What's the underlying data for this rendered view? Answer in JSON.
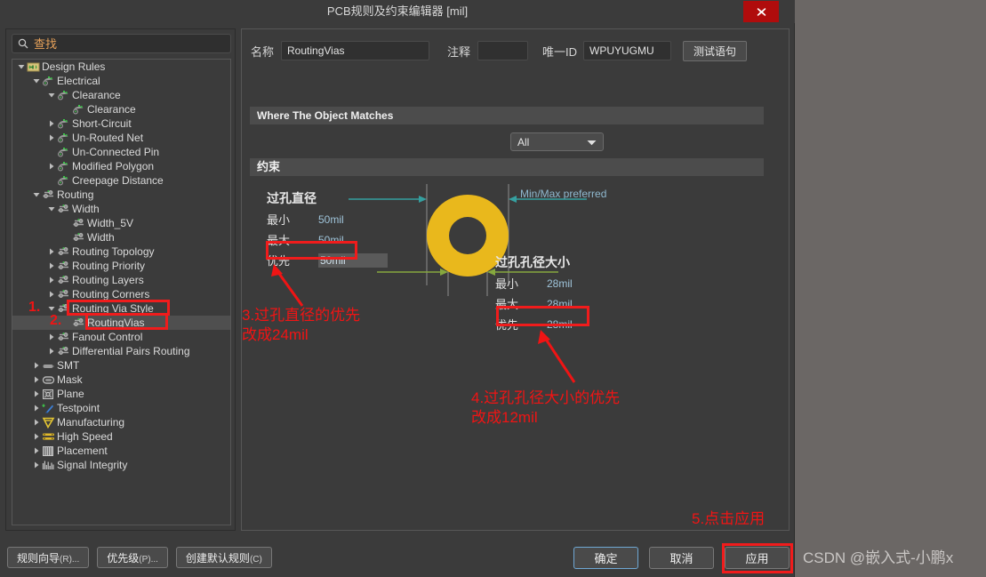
{
  "window": {
    "title": "PCB规则及约束编辑器 [mil]",
    "close_icon": "close-icon"
  },
  "sidebar": {
    "search": {
      "placeholder": "查找",
      "value": "",
      "icon": "search-icon"
    },
    "tree": [
      {
        "label": "Design Rules",
        "depth": 0,
        "twisty": "down",
        "icon": "design-rules-icon"
      },
      {
        "label": "Electrical",
        "depth": 1,
        "twisty": "down",
        "icon": "electrical-icon"
      },
      {
        "label": "Clearance",
        "depth": 2,
        "twisty": "down",
        "icon": "electrical-icon"
      },
      {
        "label": "Clearance",
        "depth": 3,
        "twisty": "none",
        "icon": "electrical-icon"
      },
      {
        "label": "Short-Circuit",
        "depth": 2,
        "twisty": "right",
        "icon": "electrical-icon"
      },
      {
        "label": "Un-Routed Net",
        "depth": 2,
        "twisty": "right",
        "icon": "electrical-icon"
      },
      {
        "label": "Un-Connected Pin",
        "depth": 2,
        "twisty": "none",
        "icon": "electrical-icon"
      },
      {
        "label": "Modified Polygon",
        "depth": 2,
        "twisty": "right",
        "icon": "electrical-icon"
      },
      {
        "label": "Creepage Distance",
        "depth": 2,
        "twisty": "none",
        "icon": "electrical-icon"
      },
      {
        "label": "Routing",
        "depth": 1,
        "twisty": "down",
        "icon": "routing-icon"
      },
      {
        "label": "Width",
        "depth": 2,
        "twisty": "down",
        "icon": "routing-icon"
      },
      {
        "label": "Width_5V",
        "depth": 3,
        "twisty": "none",
        "icon": "routing-icon"
      },
      {
        "label": "Width",
        "depth": 3,
        "twisty": "none",
        "icon": "routing-icon"
      },
      {
        "label": "Routing Topology",
        "depth": 2,
        "twisty": "right",
        "icon": "routing-icon"
      },
      {
        "label": "Routing Priority",
        "depth": 2,
        "twisty": "right",
        "icon": "routing-icon"
      },
      {
        "label": "Routing Layers",
        "depth": 2,
        "twisty": "right",
        "icon": "routing-icon"
      },
      {
        "label": "Routing Corners",
        "depth": 2,
        "twisty": "right",
        "icon": "routing-icon"
      },
      {
        "label": "Routing Via Style",
        "depth": 2,
        "twisty": "down",
        "icon": "routing-icon"
      },
      {
        "label": "RoutingVias",
        "depth": 3,
        "twisty": "none",
        "icon": "routing-icon",
        "selected": true
      },
      {
        "label": "Fanout Control",
        "depth": 2,
        "twisty": "right",
        "icon": "routing-icon"
      },
      {
        "label": "Differential Pairs Routing",
        "depth": 2,
        "twisty": "right",
        "icon": "routing-icon"
      },
      {
        "label": "SMT",
        "depth": 1,
        "twisty": "right",
        "icon": "smt-icon"
      },
      {
        "label": "Mask",
        "depth": 1,
        "twisty": "right",
        "icon": "mask-icon"
      },
      {
        "label": "Plane",
        "depth": 1,
        "twisty": "right",
        "icon": "plane-icon"
      },
      {
        "label": "Testpoint",
        "depth": 1,
        "twisty": "right",
        "icon": "testpoint-icon"
      },
      {
        "label": "Manufacturing",
        "depth": 1,
        "twisty": "right",
        "icon": "manufacturing-icon"
      },
      {
        "label": "High Speed",
        "depth": 1,
        "twisty": "right",
        "icon": "highspeed-icon"
      },
      {
        "label": "Placement",
        "depth": 1,
        "twisty": "right",
        "icon": "placement-icon"
      },
      {
        "label": "Signal Integrity",
        "depth": 1,
        "twisty": "right",
        "icon": "signal-integrity-icon"
      }
    ]
  },
  "editor": {
    "name_label": "名称",
    "name_value": "RoutingVias",
    "comment_label": "注释",
    "comment_value": "",
    "uid_label": "唯一ID",
    "uid_value": "WPUYUGMU",
    "test_query_button": "测试语句",
    "where_section": "Where The Object Matches",
    "scope_value": "All",
    "scope_options": [
      "All"
    ],
    "constraint_section": "约束",
    "minmax_hint": "Min/Max preferred",
    "via_diameter": {
      "title": "过孔直径",
      "min_label": "最小",
      "min_value": "50mil",
      "max_label": "最大",
      "max_value": "50mil",
      "preferred_label": "优先",
      "preferred_value": "50mil"
    },
    "via_hole_size": {
      "title": "过孔孔径大小",
      "min_label": "最小",
      "min_value": "28mil",
      "max_label": "最大",
      "max_value": "28mil",
      "preferred_label": "优先",
      "preferred_value": "28mil"
    }
  },
  "annotations": {
    "step1": "1.",
    "step2": "2.",
    "step3": "3.过孔直径的优先\n改成24mil",
    "step4": "4.过孔孔径大小的优先\n改成12mil",
    "step5": "5.点击应用"
  },
  "footer": {
    "rule_wizard": "规则向导",
    "rule_wizard_mn": "(R)...",
    "priority": "优先级",
    "priority_mn": "(P)...",
    "create_default": "创建默认规则",
    "create_default_mn": "(C)",
    "ok": "确定",
    "cancel": "取消",
    "apply": "应用"
  },
  "watermark": "CSDN @嵌入式-小鹏x",
  "colors": {
    "accent_red": "#f01414",
    "via_gold": "#e9b81c",
    "arrow_teal": "#35a0a0",
    "arrow_green": "#86a83e",
    "dialog_bg": "#3b3b3b",
    "desktop_bg": "#6b6765"
  }
}
